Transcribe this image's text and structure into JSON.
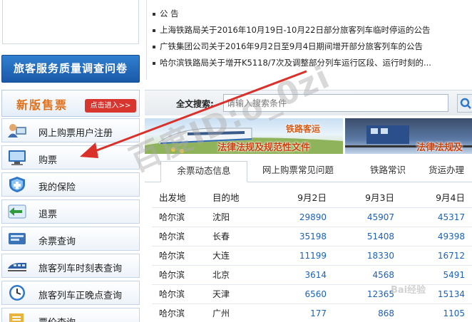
{
  "left": {
    "survey_banner": "旅客服务质量调查问卷",
    "new_ticket": {
      "title": "新版售票",
      "enter_button": "点击进入>>"
    },
    "menu": [
      {
        "label": "网上购票用户注册",
        "icon": "user-register-icon"
      },
      {
        "label": "购票",
        "icon": "computer-icon"
      },
      {
        "label": "我的保险",
        "icon": "shield-icon"
      },
      {
        "label": "退票",
        "icon": "refund-arrow-icon"
      },
      {
        "label": "余票查询",
        "icon": "ticket-query-icon"
      },
      {
        "label": "旅客列车时刻表查询",
        "icon": "train-icon"
      },
      {
        "label": "旅客列车正晚点查询",
        "icon": "clock-icon"
      },
      {
        "label": "票价查询",
        "icon": "price-icon"
      }
    ]
  },
  "news": {
    "items": [
      "公  告",
      "上海铁路局关于2016年10月19日-10月22日部分旅客列车临时停运的公告",
      "广铁集团公司关于2016年9月2日至9月4日期间增开部分旅客列车的公告",
      "哈尔滨铁路局关于增开K5118/7次及调整部分列车运行区段、运行时刻的..."
    ]
  },
  "search": {
    "label": "全文搜索:",
    "placeholder": "请输入搜索条件"
  },
  "banners": {
    "left": {
      "tag": "铁路客运",
      "text": "法律法规及规范性文件"
    },
    "right": {
      "text": "法律法规及"
    }
  },
  "tabs": [
    "余票动态信息",
    "网上购票常见问题",
    "铁路常识",
    "货运办理"
  ],
  "table": {
    "headers": [
      "出发地",
      "目的地",
      "9月2日",
      "9月3日",
      "9月4日"
    ],
    "rows": [
      [
        "哈尔滨",
        "沈阳",
        "29890",
        "45907",
        "45317"
      ],
      [
        "哈尔滨",
        "长春",
        "35198",
        "51408",
        "49398"
      ],
      [
        "哈尔滨",
        "大连",
        "11199",
        "18330",
        "16712"
      ],
      [
        "哈尔滨",
        "北京",
        "3614",
        "4568",
        "5491"
      ],
      [
        "哈尔滨",
        "天津",
        "6560",
        "12365",
        "15134"
      ],
      [
        "哈尔滨",
        "广州",
        "177",
        "868",
        "1105"
      ]
    ]
  },
  "overlays": {
    "watermark": "百度ID:o_0zi",
    "corner_mark": "Bai经验"
  },
  "colors": {
    "survey_banner_bg": "#1f62b0",
    "accent_orange": "#e0701a",
    "enter_button_bg": "#d8352e",
    "number_blue": "#1a62b8",
    "annotation_arrow": "#d9302a",
    "banner_text": "#c9420f"
  }
}
